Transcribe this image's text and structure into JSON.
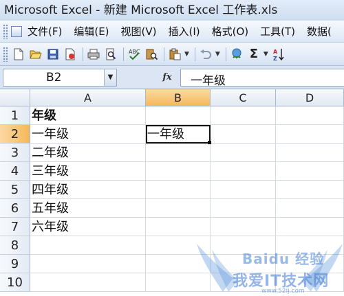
{
  "window": {
    "title": "Microsoft Excel - 新建 Microsoft Excel 工作表.xls"
  },
  "menu": {
    "items": [
      "文件(F)",
      "编辑(E)",
      "视图(V)",
      "插入(I)",
      "格式(O)",
      "工具(T)",
      "数据("
    ]
  },
  "toolbar": {
    "buttons": [
      "new-icon",
      "open-icon",
      "save-icon",
      "permission-icon",
      "print-icon",
      "print-preview-icon",
      "spelling-icon",
      "research-icon",
      "paste-icon",
      "undo-icon",
      "hyperlink-icon",
      "autosum-icon",
      "sort-ascending-icon"
    ]
  },
  "formula_bar": {
    "name_box": "B2",
    "fx_label": "fx",
    "formula": "一年级"
  },
  "sheet": {
    "columns": [
      "A",
      "B",
      "C",
      "D"
    ],
    "rows": [
      "1",
      "2",
      "3",
      "4",
      "5",
      "6",
      "7",
      "8",
      "9",
      "10"
    ],
    "selected_column": "B",
    "selected_row": "2",
    "active_cell": "B2",
    "column_a": [
      "年级",
      "一年级",
      "二年级",
      "三年级",
      "四年级",
      "五年级",
      "六年级",
      "",
      "",
      ""
    ],
    "b2_value": "一年级"
  },
  "watermark": {
    "baidu": "Baidu 经验",
    "site": "我爱IT技术网",
    "url": "www.52ij.com"
  }
}
